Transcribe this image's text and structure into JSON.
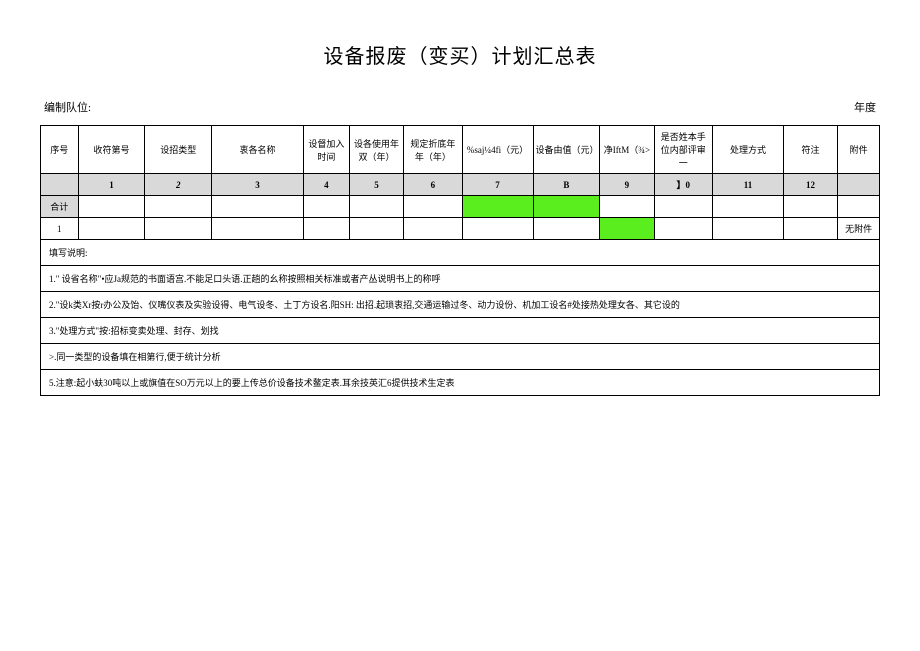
{
  "title": "设备报废（变买）计划汇总表",
  "meta": {
    "left_label": "编制队位:",
    "right_label": "年度"
  },
  "headers": {
    "c1": "序号",
    "c2": "收符第号",
    "c3": "设招类型",
    "c4": "衷各名称",
    "c5": "设督加入时间",
    "c6": "设各使用年双（年）",
    "c7": "规定折底年年（年）",
    "c8": "%saj¼4fi（元）",
    "c9": "设备由值（元）",
    "c10": "净IftM（¾>",
    "c11": "是否姓本手位内部评审一",
    "c12": "处理方式",
    "c13": "符注",
    "c14": "附件"
  },
  "num_row": {
    "n1": "",
    "n2": "1",
    "n3": "2",
    "n4": "3",
    "n5": "4",
    "n6": "5",
    "n7": "6",
    "n8": "7",
    "n9": "B",
    "n10": "9",
    "n11": "】0",
    "n12": "11",
    "n13": "12",
    "n14": ""
  },
  "subtotal_label": "合计",
  "data_row": {
    "r1": "1",
    "attach": "无附件"
  },
  "notes_header": "填写说明:",
  "notes": [
    "1.\" 设省名称\"•应Ja规范的书面语宫.不能足口头语.正趟的幺称按照相关标准或者产丛说明书上的称呼",
    "2.\"设k类Xr按r办公及饴、仪嘴仪表及实验设得、电气设冬、土丁方设名.阳SH: 出招.起琐衷招,交通运输过冬、动力设份、机加工设名#处接热处理女各、其它设的",
    "3.\"处理方式\"按:招标变卖处理、封存、划找",
    ">.同一类型的设备填在相第行,便于统计分析",
    "5.注意:起小蚨30吨以上或旗值在SO万元以上的要上传总价设备技术鳌定表.耳余技英汇6提供技术生定表"
  ]
}
